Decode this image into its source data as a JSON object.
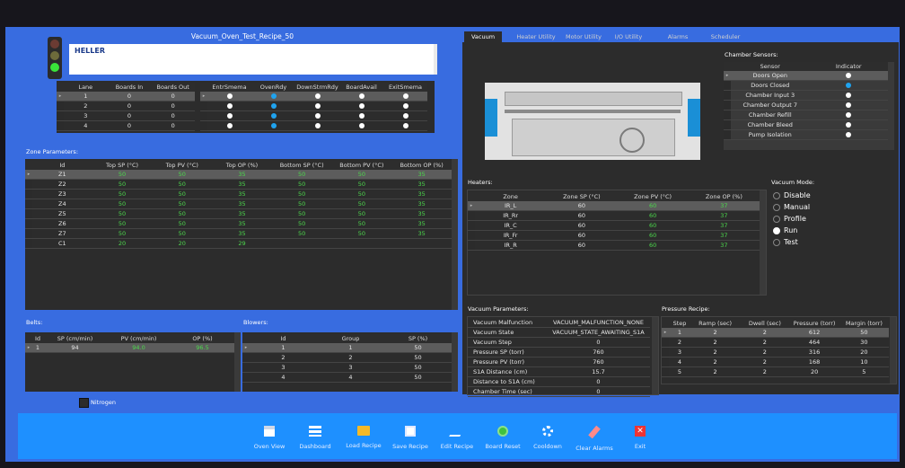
{
  "recipe": {
    "title": "Vacuum_Oven_Test_Recipe_50"
  },
  "logo": {
    "text": "HELLER"
  },
  "lane_table": {
    "headers": [
      "Lane",
      "Boards In",
      "Boards Out"
    ],
    "rows": [
      [
        "1",
        "0",
        "0"
      ],
      [
        "2",
        "0",
        "0"
      ],
      [
        "3",
        "0",
        "0"
      ],
      [
        "4",
        "0",
        "0"
      ]
    ]
  },
  "smema_table": {
    "headers": [
      "EntrSmema",
      "OvenRdy",
      "DownStrmRdy",
      "BoardAvail",
      "ExitSmema"
    ],
    "rows": [
      [
        "white",
        "blue",
        "white",
        "white",
        "white"
      ],
      [
        "white",
        "blue",
        "white",
        "white",
        "white"
      ],
      [
        "white",
        "blue",
        "white",
        "white",
        "white"
      ],
      [
        "white",
        "blue",
        "white",
        "white",
        "white"
      ]
    ]
  },
  "zones": {
    "label": "Zone Parameters:",
    "headers": [
      "Id",
      "Top SP (°C)",
      "Top PV (°C)",
      "Top OP (%)",
      "Bottom SP (°C)",
      "Bottom PV (°C)",
      "Bottom OP (%)"
    ],
    "rows": [
      [
        "Z1",
        "50",
        "50",
        "35",
        "50",
        "50",
        "35"
      ],
      [
        "Z2",
        "50",
        "50",
        "35",
        "50",
        "50",
        "35"
      ],
      [
        "Z3",
        "50",
        "50",
        "35",
        "50",
        "50",
        "35"
      ],
      [
        "Z4",
        "50",
        "50",
        "35",
        "50",
        "50",
        "35"
      ],
      [
        "Z5",
        "50",
        "50",
        "35",
        "50",
        "50",
        "35"
      ],
      [
        "Z6",
        "50",
        "50",
        "35",
        "50",
        "50",
        "35"
      ],
      [
        "Z7",
        "50",
        "50",
        "35",
        "50",
        "50",
        "35"
      ],
      [
        "C1",
        "20",
        "20",
        "29",
        "",
        "",
        ""
      ]
    ]
  },
  "belts": {
    "label": "Belts:",
    "headers": [
      "Id",
      "SP (cm/min)",
      "PV (cm/min)",
      "OP (%)"
    ],
    "rows": [
      [
        "1",
        "94",
        "94.0",
        "96.5"
      ]
    ]
  },
  "blowers": {
    "label": "Blowers:",
    "headers": [
      "Id",
      "Group",
      "SP (%)"
    ],
    "rows": [
      [
        "1",
        "1",
        "50"
      ],
      [
        "2",
        "2",
        "50"
      ],
      [
        "3",
        "3",
        "50"
      ],
      [
        "4",
        "4",
        "50"
      ]
    ]
  },
  "nitrogen": {
    "label": "Nitrogen"
  },
  "tabs": [
    "Vacuum",
    "Heater Utility",
    "Motor Utility",
    "I/O Utility",
    "Alarms",
    "Scheduler"
  ],
  "sensors": {
    "label": "Chamber Sensors:",
    "headers": [
      "Sensor",
      "Indicator"
    ],
    "rows": [
      [
        "Doors Open",
        "white"
      ],
      [
        "Doors Closed",
        "blue"
      ],
      [
        "Chamber Input 3",
        "white"
      ],
      [
        "Chamber Output 7",
        "white"
      ],
      [
        "Chamber Refill",
        "white"
      ],
      [
        "Chamber Bleed",
        "white"
      ],
      [
        "Pump Isolation",
        "white"
      ]
    ]
  },
  "heaters": {
    "label": "Heaters:",
    "headers": [
      "Zone",
      "Zone SP (°C)",
      "Zone PV (°C)",
      "Zone OP (%)"
    ],
    "rows": [
      [
        "IR_L",
        "60",
        "60",
        "37"
      ],
      [
        "IR_Rr",
        "60",
        "60",
        "37"
      ],
      [
        "IR_C",
        "60",
        "60",
        "37"
      ],
      [
        "IR_Fr",
        "60",
        "60",
        "37"
      ],
      [
        "IR_R",
        "60",
        "60",
        "37"
      ]
    ]
  },
  "vacuum_mode": {
    "label": "Vacuum Mode:",
    "options": [
      "Disable",
      "Manual",
      "Profile",
      "Run",
      "Test"
    ],
    "selected": "Run"
  },
  "vacuum_params": {
    "label": "Vacuum Parameters:",
    "rows": [
      [
        "Vacuum Malfunction",
        "VACUUM_MALFUNCTION_NONE"
      ],
      [
        "Vacuum State",
        "VACUUM_STATE_AWAITING_S1A"
      ],
      [
        "Vacuum Step",
        "0"
      ],
      [
        "Pressure SP (torr)",
        "760"
      ],
      [
        "Pressure PV (torr)",
        "760"
      ],
      [
        "S1A Distance (cm)",
        "15.7"
      ],
      [
        "Distance to S1A (cm)",
        "0"
      ],
      [
        "Chamber Time (sec)",
        "0"
      ]
    ]
  },
  "pressure_recipe": {
    "label": "Pressure Recipe:",
    "headers": [
      "Step",
      "Ramp (sec)",
      "Dwell (sec)",
      "Pressure (torr)",
      "Margin (torr)"
    ],
    "rows": [
      [
        "1",
        "2",
        "2",
        "612",
        "50"
      ],
      [
        "2",
        "2",
        "2",
        "464",
        "30"
      ],
      [
        "3",
        "2",
        "2",
        "316",
        "20"
      ],
      [
        "4",
        "2",
        "2",
        "168",
        "10"
      ],
      [
        "5",
        "2",
        "2",
        "20",
        "5"
      ]
    ]
  },
  "toolbar": [
    "Oven View",
    "Dashboard",
    "Load Recipe",
    "Save Recipe",
    "Edit Recipe",
    "Board Reset",
    "Cooldown",
    "Clear Alarms",
    "Exit"
  ],
  "colors": {
    "background": "#386ce0",
    "panel": "#2c2c2c",
    "pv_green": "#4cd94c",
    "indicator_blue": "#1fa3ef",
    "toolbar": "#1e90ff"
  }
}
